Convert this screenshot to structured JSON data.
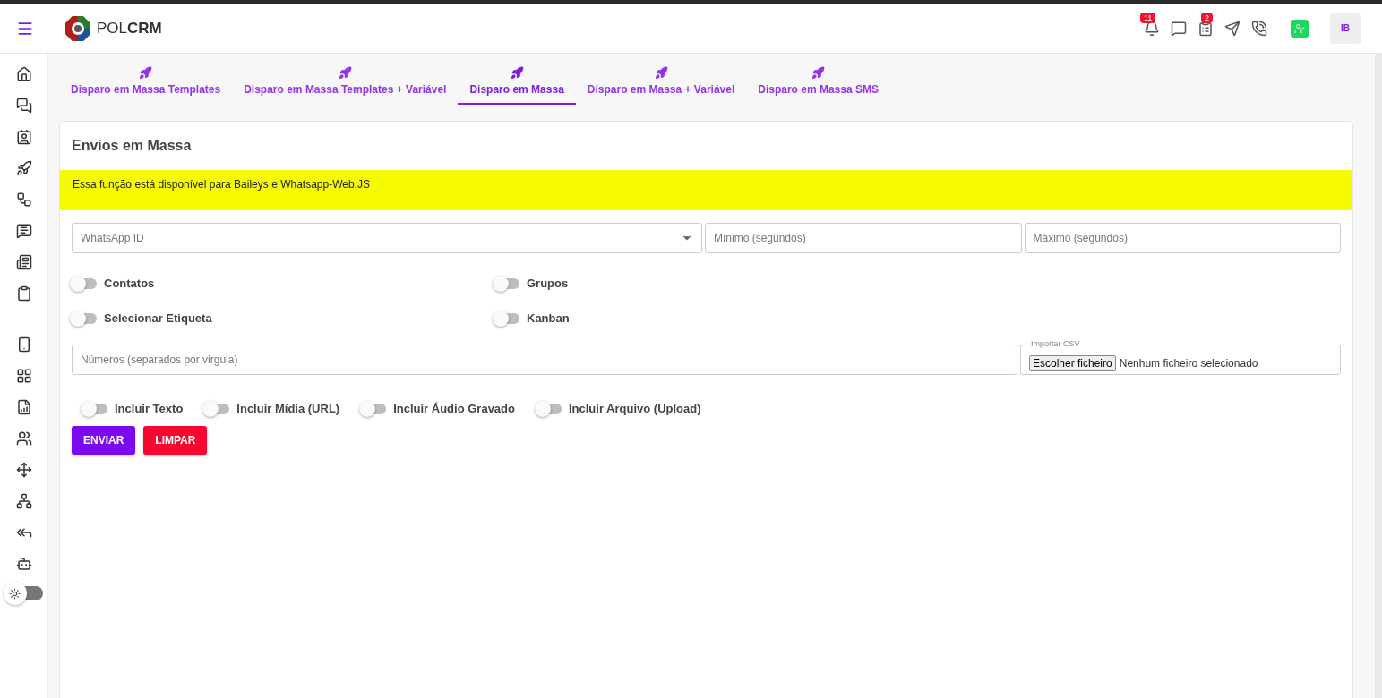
{
  "header": {
    "logo_text_light": "POL",
    "logo_text_bold": "CRM",
    "notifications_badge": "11",
    "tasks_badge": "2",
    "avatar_initials": "IB"
  },
  "sidebar": {
    "dark_mode": false
  },
  "tabs": [
    {
      "label": "Disparo em Massa Templates",
      "selected": false
    },
    {
      "label": "Disparo em Massa Templates + Variável",
      "selected": false
    },
    {
      "label": "Disparo em Massa",
      "selected": true
    },
    {
      "label": "Disparo em Massa + Variável",
      "selected": false
    },
    {
      "label": "Disparo em Massa SMS",
      "selected": false
    }
  ],
  "card": {
    "title": "Envios em Massa",
    "notice": "Essa função está disponível para Baileys e Whatsapp-Web.JS",
    "whatsapp_select": {
      "placeholder": "WhatsApp ID"
    },
    "min_field": {
      "placeholder": "Mínimo (segundos)"
    },
    "max_field": {
      "placeholder": "Máximo (segundos)"
    },
    "audience_toggles": [
      {
        "label": "Contatos",
        "on": false
      },
      {
        "label": "Grupos",
        "on": false
      },
      {
        "label": "Selecionar Etiqueta",
        "on": false
      },
      {
        "label": "Kanban",
        "on": false
      }
    ],
    "numbers_field": {
      "placeholder": "Números (separados por virgula)"
    },
    "csv": {
      "label": "Importar CSV",
      "button": "Escolher ficheiro",
      "status": "Nenhum ficheiro selecionado"
    },
    "content_toggles": [
      {
        "label": "Incluir Texto",
        "on": false
      },
      {
        "label": "Incluir Mídia (URL)",
        "on": false
      },
      {
        "label": "Incluir Áudio Gravado",
        "on": false
      },
      {
        "label": "Incluir Arquivo (Upload)",
        "on": false
      }
    ],
    "buttons": [
      {
        "label": "ENVIAR",
        "kind": "primary"
      },
      {
        "label": "LIMPAR",
        "kind": "danger"
      }
    ]
  }
}
